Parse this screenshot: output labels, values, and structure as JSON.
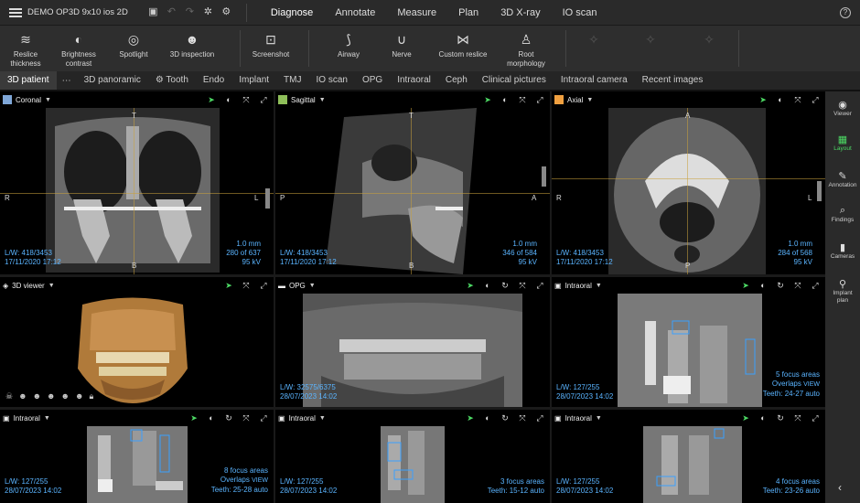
{
  "app": {
    "title": "DEMO OP3D 9x10 ios 2D"
  },
  "menu": [
    "Diagnose",
    "Annotate",
    "Measure",
    "Plan",
    "3D X-ray",
    "IO scan"
  ],
  "toolbar": {
    "tools": [
      {
        "label": "Reslice\nthickness",
        "icon": "layers-icon"
      },
      {
        "label": "Brightness\ncontrast",
        "icon": "contrast-icon"
      },
      {
        "label": "Spotlight",
        "icon": "spotlight-icon"
      },
      {
        "label": "3D inspection",
        "icon": "head-icon"
      },
      {
        "label": "Screenshot",
        "icon": "screenshot-icon"
      },
      {
        "label": "Airway",
        "icon": "airway-icon"
      },
      {
        "label": "Nerve",
        "icon": "nerve-icon"
      },
      {
        "label": "Custom reslice",
        "icon": "reslice-icon"
      },
      {
        "label": "Root\nmorphology",
        "icon": "tooth-icon"
      }
    ]
  },
  "tabs": [
    "3D patient",
    "3D panoramic",
    "Tooth",
    "Endo",
    "Implant",
    "TMJ",
    "IO scan",
    "OPG",
    "Intraoral",
    "Ceph",
    "Clinical pictures",
    "Intraoral camera",
    "Recent images"
  ],
  "viewports": {
    "coronal": {
      "title": "Coronal",
      "color": "#7fa7d8",
      "top": "T",
      "bottom": "B",
      "left": "R",
      "right": "L",
      "lw": "L/W: 418/3453",
      "date": "17/11/2020 17:12",
      "thick": "1.0 mm",
      "slice": "280 of 637",
      "kv": "95 kV"
    },
    "sagittal": {
      "title": "Sagittal",
      "color": "#8fbf5a",
      "top": "T",
      "bottom": "B",
      "left": "P",
      "right": "A",
      "lw": "L/W: 418/3453",
      "date": "17/11/2020 17:12",
      "thick": "1.0 mm",
      "slice": "346 of 584",
      "kv": "95 kV"
    },
    "axial": {
      "title": "Axial",
      "color": "#f0a040",
      "top": "A",
      "bottom": "P",
      "left": "R",
      "right": "L",
      "lw": "L/W: 418/3453",
      "date": "17/11/2020 17:12",
      "thick": "1.0 mm",
      "slice": "284 of 568",
      "kv": "95 kV"
    },
    "viewer3d": {
      "title": "3D viewer"
    },
    "opg": {
      "title": "OPG",
      "lw": "L/W: 32575/6375",
      "date": "28/07/2023 14:02"
    },
    "intraoral1": {
      "title": "Intraoral",
      "lw": "L/W: 127/255",
      "date": "28/07/2023 14:02",
      "focus": "5 focus areas",
      "overlaps": "Overlaps",
      "view": "VIEW",
      "teeth": "Teeth: 24-27",
      "mode": "auto"
    },
    "intraoral2": {
      "title": "Intraoral",
      "lw": "L/W: 127/255",
      "date": "28/07/2023 14:02",
      "focus": "8 focus areas",
      "overlaps": "Overlaps",
      "view": "VIEW",
      "teeth": "Teeth: 25-28",
      "mode": "auto"
    },
    "intraoral3": {
      "title": "Intraoral",
      "lw": "L/W: 127/255",
      "date": "28/07/2023 14:02",
      "focus": "3 focus areas",
      "teeth": "Teeth: 15-12",
      "mode": "auto"
    },
    "intraoral4": {
      "title": "Intraoral",
      "lw": "L/W: 127/255",
      "date": "28/07/2023 14:02",
      "focus": "4 focus areas",
      "teeth": "Teeth: 23-26",
      "mode": "auto"
    }
  },
  "sidebar": [
    {
      "label": "Viewer",
      "icon": "eye-icon"
    },
    {
      "label": "Layout",
      "icon": "layout-icon"
    },
    {
      "label": "Annotation",
      "icon": "pen-icon"
    },
    {
      "label": "Findings",
      "icon": "findings-icon"
    },
    {
      "label": "Cameras",
      "icon": "camera-icon"
    },
    {
      "label": "Implant\nplan",
      "icon": "implant-icon"
    }
  ]
}
